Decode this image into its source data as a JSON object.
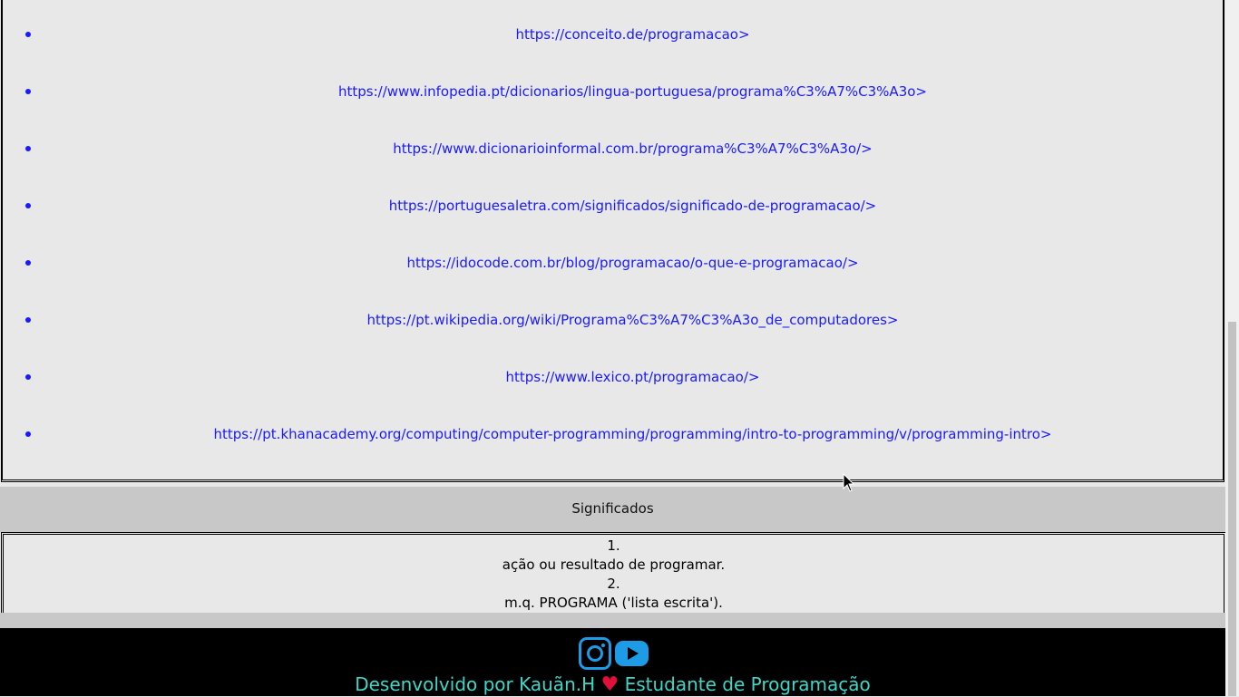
{
  "links": [
    "https://conceito.de/programacao>",
    "https://www.infopedia.pt/dicionarios/lingua-portuguesa/programa%C3%A7%C3%A3o>",
    "https://www.dicionarioinformal.com.br/programa%C3%A7%C3%A3o/>",
    "https://portuguesaletra.com/significados/significado-de-programacao/>",
    "https://idocode.com.br/blog/programacao/o-que-e-programacao/>",
    "https://pt.wikipedia.org/wiki/Programa%C3%A7%C3%A3o_de_computadores>",
    "https://www.lexico.pt/programacao/>",
    "https://pt.khanacademy.org/computing/computer-programming/programming/intro-to-programming/v/programming-intro>"
  ],
  "section": {
    "title": "Significados"
  },
  "meanings": [
    {
      "number": "1.",
      "text": "ação ou resultado de programar."
    },
    {
      "number": "2.",
      "text": "m.q. PROGRAMA ('lista escrita')."
    }
  ],
  "footer": {
    "icons": [
      "instagram-icon",
      "youtube-icon"
    ],
    "credit_prefix": "Desenvolvido por Kauãn.H",
    "heart": "♥",
    "credit_suffix": "Estudante de Programação"
  },
  "colors": {
    "link": "#1a1aff",
    "footer_text": "#3fd6c8",
    "icon": "#1e9be6",
    "heart": "#e0103a"
  }
}
